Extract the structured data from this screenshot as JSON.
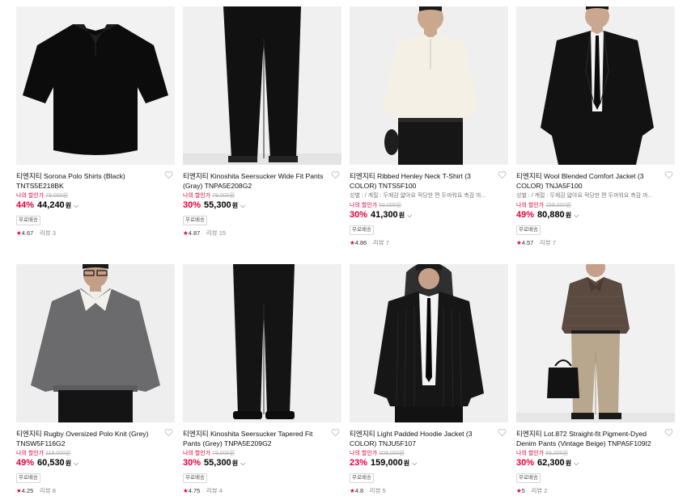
{
  "products": [
    {
      "title": "티엔지티 Sorona Polo Shirts (Black) TNTS5E218BK",
      "spec": "",
      "my_price_label": "나의 할인가",
      "original_price": "79,000원",
      "discount": "44%",
      "price": "44,240",
      "currency": "원",
      "badge": "무료배송",
      "rating": "4.67",
      "reviews": "리뷰 3",
      "image": "black polo shirt"
    },
    {
      "title": "티엔지티 Kinoshita Seersucker Wide Fit Pants (Gray) TNPA5E208G2",
      "spec": "",
      "my_price_label": "나의 할인가",
      "original_price": "79,000원",
      "discount": "30%",
      "price": "55,300",
      "currency": "원",
      "badge": "무료배송",
      "rating": "4.87",
      "reviews": "리뷰 15",
      "image": "black wide pants"
    },
    {
      "title": "티엔지티 Ribbed Henley Neck T-Shirt (3 COLOR) TNTS5F100",
      "spec": "성별 : / 계절 : 두께감 얇아요 적당한 편 두꺼워요 촉감 까...",
      "my_price_label": "나의 할인가",
      "original_price": "59,000원",
      "discount": "30%",
      "price": "41,300",
      "currency": "원",
      "badge": "무료배송",
      "rating": "4.86",
      "reviews": "리뷰 7",
      "image": "cream henley t-shirt"
    },
    {
      "title": "티엔지티 Wool Blended Comfort Jacket (3 COLOR) TNJA5F100",
      "spec": "성별 : / 계절 : 두께감 얇아요 적당한 편 두꺼워요 촉감 까...",
      "my_price_label": "나의 할인가",
      "original_price": "159,000원",
      "discount": "49%",
      "price": "80,880",
      "currency": "원",
      "badge": "무료배송",
      "rating": "4.57",
      "reviews": "리뷰 7",
      "image": "black suit jacket"
    },
    {
      "title": "티엔지티 Rugby Oversized Polo Knit (Grey) TNSW5F116G2",
      "spec": "",
      "my_price_label": "나의 할인가",
      "original_price": "119,000원",
      "discount": "49%",
      "price": "60,530",
      "currency": "원",
      "badge": "무료배송",
      "rating": "4.25",
      "reviews": "리뷰 8",
      "image": "grey rugby knit"
    },
    {
      "title": "티엔지티 Kinoshita Seersucker Tapered Fit Pants (Grey) TNPA5E209G2",
      "spec": "",
      "my_price_label": "나의 할인가",
      "original_price": "79,000원",
      "discount": "30%",
      "price": "55,300",
      "currency": "원",
      "badge": "무료배송",
      "rating": "4.75",
      "reviews": "리뷰 4",
      "image": "black tapered pants"
    },
    {
      "title": "티엔지티 Light Padded Hoodie Jacket (3 COLOR) TNJU5F107",
      "spec": "",
      "my_price_label": "나의 할인가",
      "original_price": "209,000원",
      "discount": "23%",
      "price": "159,000",
      "currency": "원",
      "badge": "무료배송",
      "rating": "4.8",
      "reviews": "리뷰 5",
      "image": "black padded hoodie jacket"
    },
    {
      "title": "티엔지티 Lot.872 Straight-fit Pigment-Dyed Denim Pants (Vintage Beige) TNPA5F109I2",
      "spec": "",
      "my_price_label": "나의 할인가",
      "original_price": "89,000원",
      "discount": "30%",
      "price": "62,300",
      "currency": "원",
      "badge": "무료배송",
      "rating": "5",
      "reviews": "리뷰 2",
      "image": "beige denim pants with brown knit"
    }
  ],
  "icons": {
    "heart": "heart-icon",
    "star": "star-icon",
    "chevron": "chevron-down-icon"
  },
  "colors": {
    "accent": "#e3003b",
    "image_bg": "#f1f1f1"
  }
}
